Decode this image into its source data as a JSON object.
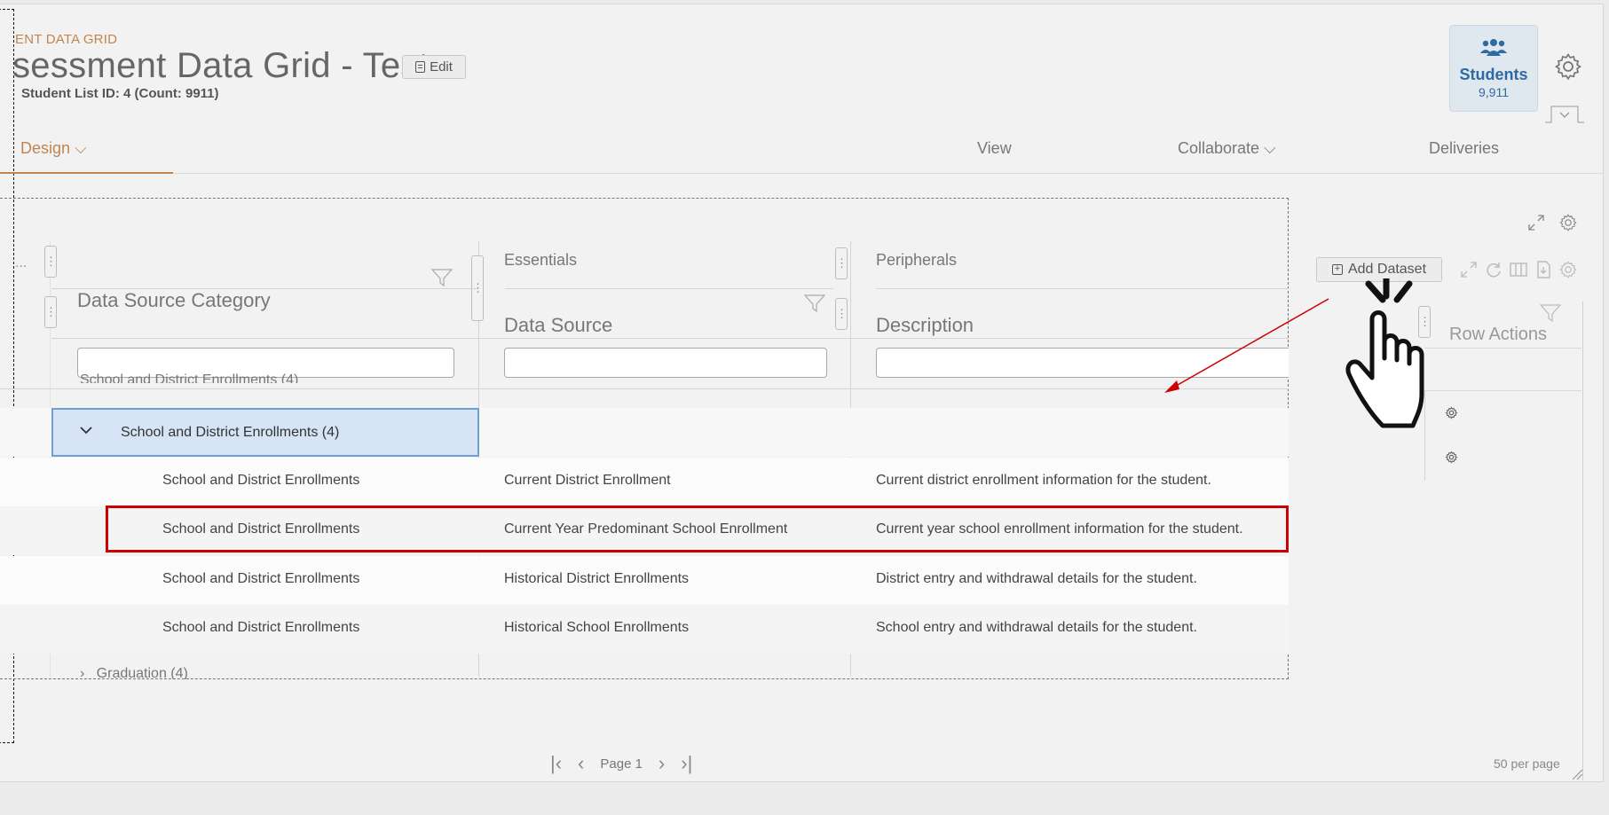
{
  "header": {
    "breadcrumb": "ENT DATA GRID",
    "title": "sessment Data Grid - Test",
    "edit_label": "Edit",
    "subline": "Student List ID: 4 (Count: 9911)",
    "students_label": "Students",
    "students_count": "9,911"
  },
  "tabs": [
    {
      "label": "Design ⌵"
    },
    {
      "label": "View"
    },
    {
      "label": "Collaborate ⌵"
    },
    {
      "label": "Deliveries"
    }
  ],
  "grid": {
    "left_stub": "...",
    "group_headers": [
      "Essentials",
      "Peripherals"
    ],
    "columns": [
      "Data Source Category",
      "Data Source",
      "Description"
    ],
    "partial_top_row": "School and District Enrollments (4)",
    "group_row": {
      "label": "School and District Enrollments (4)"
    },
    "rows": [
      {
        "category": "School and District Enrollments",
        "source": "Current District Enrollment",
        "description": "Current district enrollment information for the student."
      },
      {
        "category": "School and District Enrollments",
        "source": "Current Year Predominant School Enrollment",
        "description": "Current year school enrollment information for the student."
      },
      {
        "category": "School and District Enrollments",
        "source": "Historical District Enrollments",
        "description": "District entry and withdrawal details for the student."
      },
      {
        "category": "School and District Enrollments",
        "source": "Historical School Enrollments",
        "description": "School entry and withdrawal details for the student."
      }
    ],
    "partial_bottom_row": "Graduation (4)"
  },
  "right_panel": {
    "add_dataset_label": "Add Dataset",
    "row_actions_label": "Row Actions"
  },
  "pager": {
    "page_label": "Page 1",
    "per_page": "50 per page"
  },
  "colors": {
    "accent": "#c0854d",
    "brand_blue": "#2f6aa3",
    "highlight_red": "#cc0000",
    "selected_row": "#d6e4f5"
  }
}
